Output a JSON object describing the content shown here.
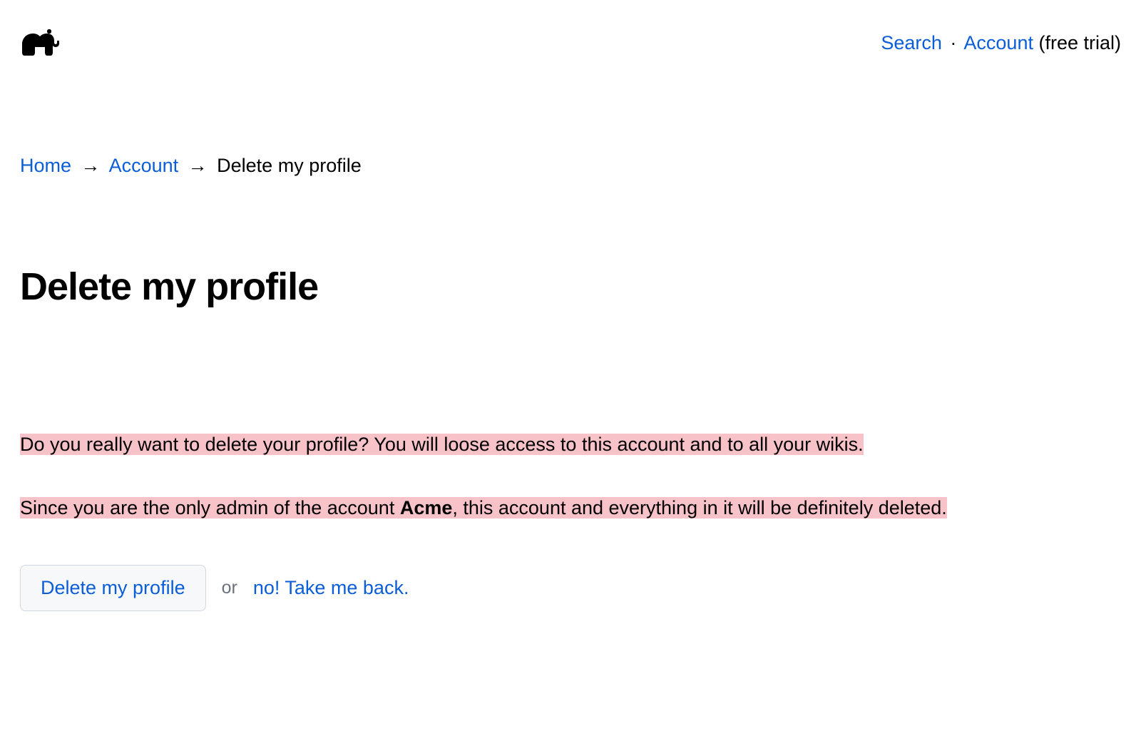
{
  "header": {
    "nav": {
      "search": "Search",
      "separator": "·",
      "account": "Account",
      "trial_suffix": "(free trial)"
    }
  },
  "breadcrumb": {
    "home": "Home",
    "account": "Account",
    "current": "Delete my profile",
    "arrow": "→"
  },
  "page": {
    "title": "Delete my profile"
  },
  "warning": {
    "line1": "Do you really want to delete your profile? You will loose access to this account and to all your wikis.",
    "line2_prefix": "Since you are the only admin of the account ",
    "account_name": "Acme",
    "line2_suffix": ", this account and everything in it will be definitely deleted."
  },
  "actions": {
    "delete_button": "Delete my profile",
    "or": "or",
    "back_link": "no! Take me back."
  }
}
